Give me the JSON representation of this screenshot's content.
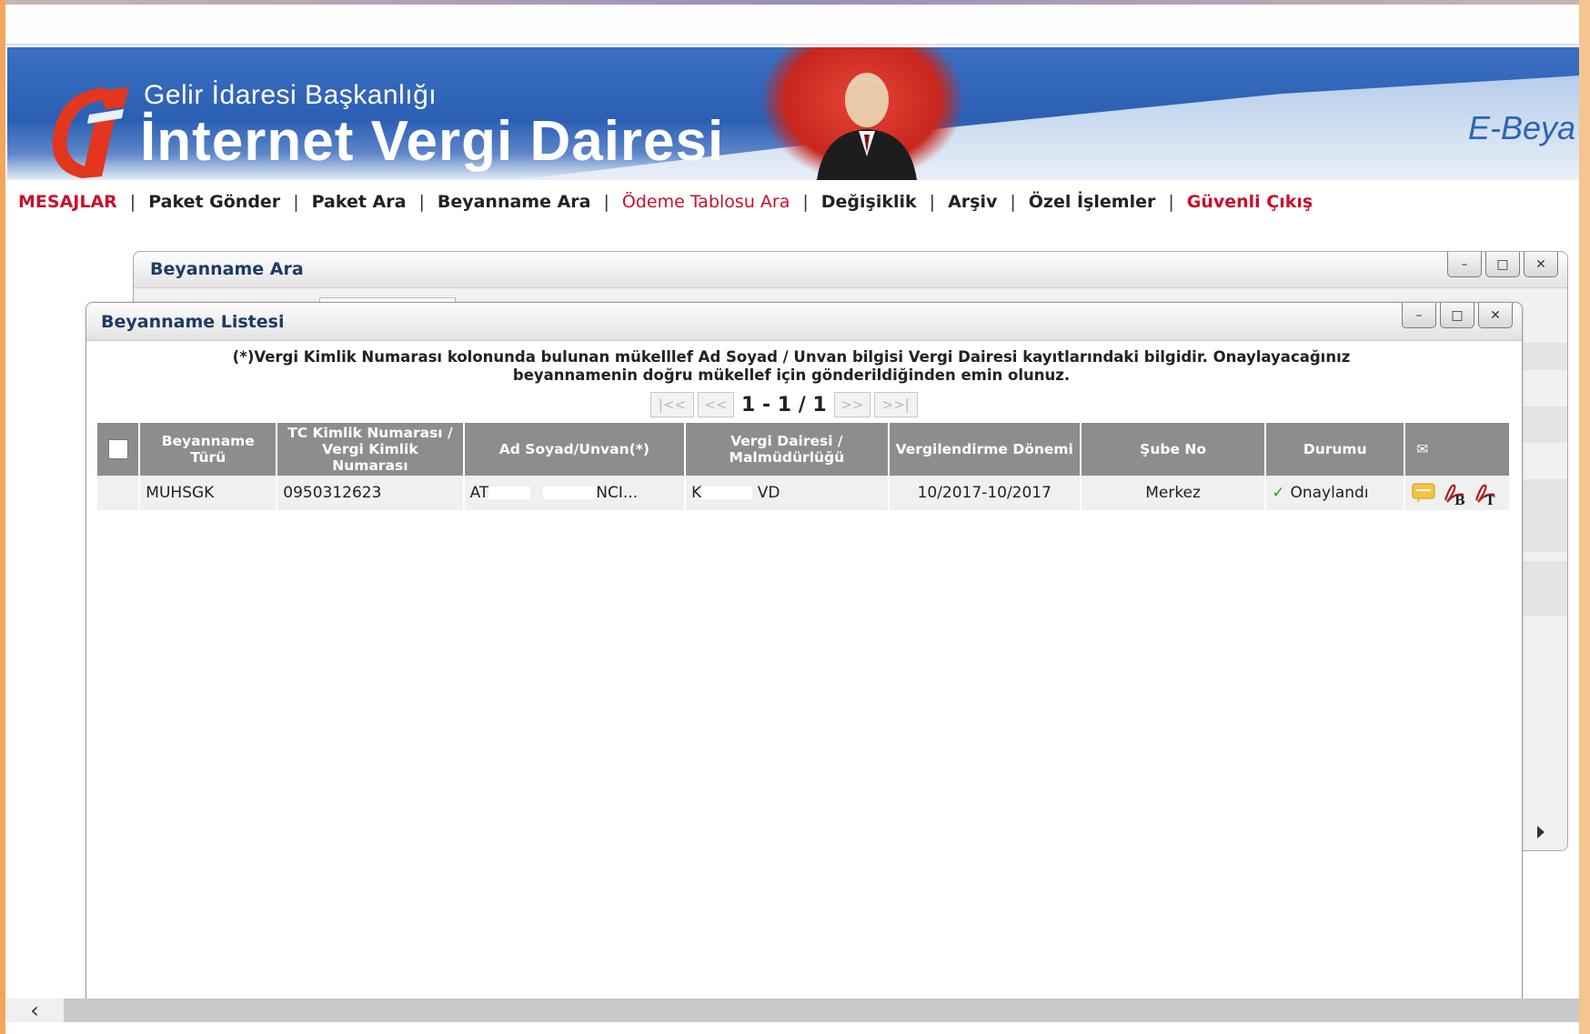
{
  "banner": {
    "subtitle": "Gelir İdaresi Başkanlığı",
    "title": "İnternet Vergi Dairesi",
    "right_label": "E-Beya"
  },
  "nav": {
    "items": [
      {
        "label": "MESAJLAR"
      },
      {
        "label": "Paket Gönder"
      },
      {
        "label": "Paket Ara"
      },
      {
        "label": "Beyanname Ara"
      },
      {
        "label": "Ödeme Tablosu Ara"
      },
      {
        "label": "Değişiklik"
      },
      {
        "label": "Arşiv"
      },
      {
        "label": "Özel İşlemler"
      },
      {
        "label": "Güvenli Çıkış"
      }
    ],
    "separator": "|"
  },
  "back_window": {
    "title": "Beyanname Ara"
  },
  "window_controls": {
    "minimize": "–",
    "maximize": "□",
    "close": "✕"
  },
  "list_window": {
    "title": "Beyanname Listesi",
    "notice_line1": "(*)Vergi Kimlik Numarası kolonunda bulunan mükelllef Ad Soyad / Unvan bilgisi Vergi Dairesi kayıtlarındaki bilgidir. Onaylayacağınız",
    "notice_line2": "beyannamenin doğru mükellef için gönderildiğinden emin olunuz.",
    "pager": {
      "first": "|<<",
      "prev": "<<",
      "text": "1 - 1 / 1",
      "next": ">>",
      "last": ">>|"
    },
    "columns": {
      "type": "Beyanname Türü",
      "tc": "TC Kimlik Numarası / Vergi Kimlik Numarası",
      "name": "Ad Soyad/Unvan(*)",
      "office": "Vergi Dairesi / Malmüdürlüğü",
      "period": "Vergilendirme Dönemi",
      "branch": "Şube No",
      "status": "Durumu",
      "mail_icon": "✉"
    },
    "rows": [
      {
        "type": "MUHSGK",
        "tc": "0950312623",
        "name_start": "AT",
        "name_end": "NCI...",
        "office_start": "K",
        "office_end": "VD",
        "period": "10/2017-10/2017",
        "branch": "Merkez",
        "status_mark": "✓",
        "status": "Onaylandı"
      }
    ]
  },
  "scrollbar": {
    "left_arrow": "‹"
  },
  "colors": {
    "nav_red": "#c8102e",
    "header_gray": "#8d8d8d",
    "title_blue": "#1f3b63",
    "banner_blue": "#2c5fb3"
  }
}
